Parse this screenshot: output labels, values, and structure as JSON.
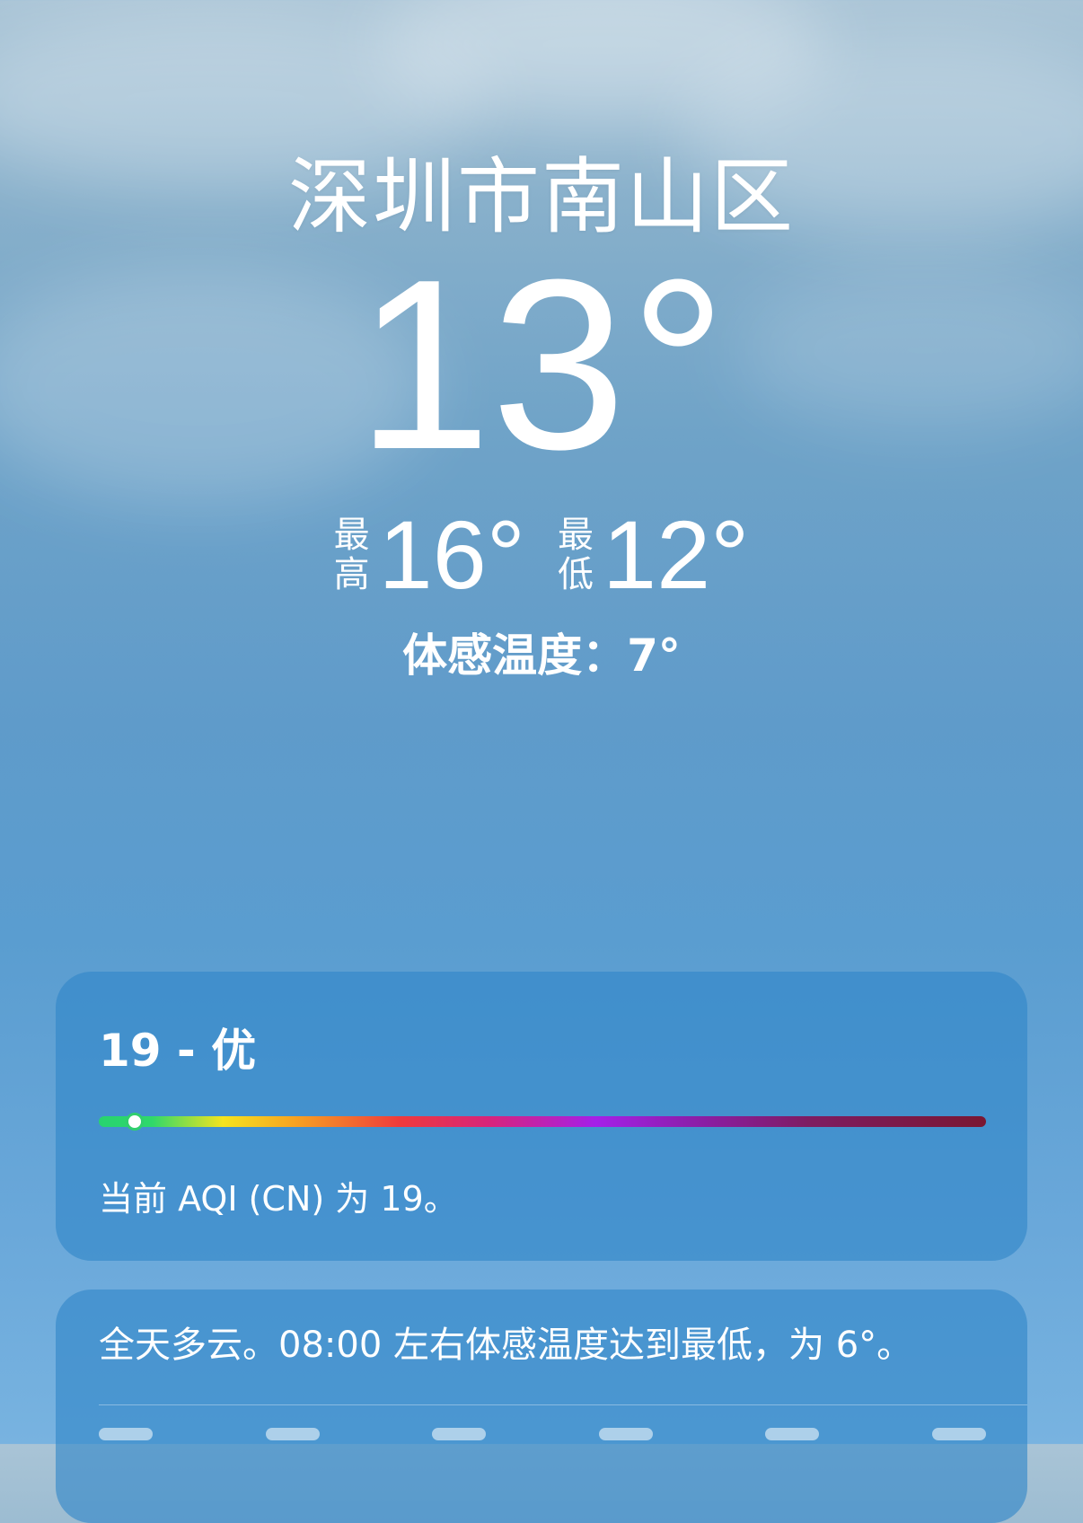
{
  "weather": {
    "location": "深圳市南山区",
    "current_temp": "13",
    "degree_symbol": "°",
    "high_label_top": "最",
    "high_label_bottom": "高",
    "high_value": "16°",
    "low_label_top": "最",
    "low_label_bottom": "低",
    "low_value": "12°",
    "feels_like": "体感温度：7°"
  },
  "aqi": {
    "title": "19 - 优",
    "value": 19,
    "scale_max": 500,
    "description": "当前 AQI (CN) 为 19。"
  },
  "summary": {
    "text": "全天多云。08:00 左右体感温度达到最低，为 6°。"
  },
  "colors": {
    "card_background": "#3086c8",
    "aqi_indicator": "#31cf6d",
    "text": "#ffffff"
  }
}
